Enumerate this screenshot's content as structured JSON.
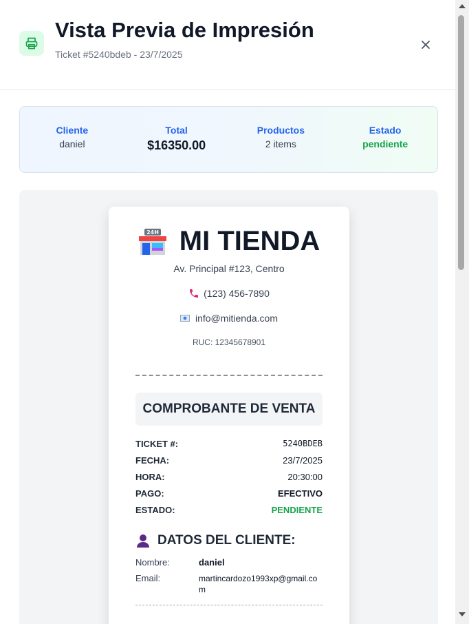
{
  "header": {
    "title": "Vista Previa de Impresión",
    "subtitle": "Ticket #5240bdeb - 23/7/2025",
    "icon": "printer-icon",
    "accent": "#16a34a"
  },
  "summary": {
    "cliente_label": "Cliente",
    "cliente_value": "daniel",
    "total_label": "Total",
    "total_value": "$16350.00",
    "productos_label": "Productos",
    "productos_value": "2 items",
    "estado_label": "Estado",
    "estado_value": "pendiente"
  },
  "ticket": {
    "store_name": "MI TIENDA",
    "store_icon": "convenience-store-icon",
    "address": "Av. Principal #123, Centro",
    "phone": "(123) 456-7890",
    "email": "info@mitienda.com",
    "ruc": "RUC: 12345678901",
    "doc_title": "COMPROBANTE DE VENTA",
    "info": [
      {
        "label": "TICKET #:",
        "value": "5240BDEB"
      },
      {
        "label": "FECHA:",
        "value": "23/7/2025"
      },
      {
        "label": "HORA:",
        "value": "20:30:00"
      },
      {
        "label": "PAGO:",
        "value": "EFECTIVO"
      },
      {
        "label": "ESTADO:",
        "value": "PENDIENTE"
      }
    ],
    "client_section_title": "DATOS DEL CLIENTE:",
    "client": {
      "name_label": "Nombre:",
      "name_value": "daniel",
      "email_label": "Email:",
      "email_value": "martincardozo1993xp@gmail.com"
    }
  }
}
